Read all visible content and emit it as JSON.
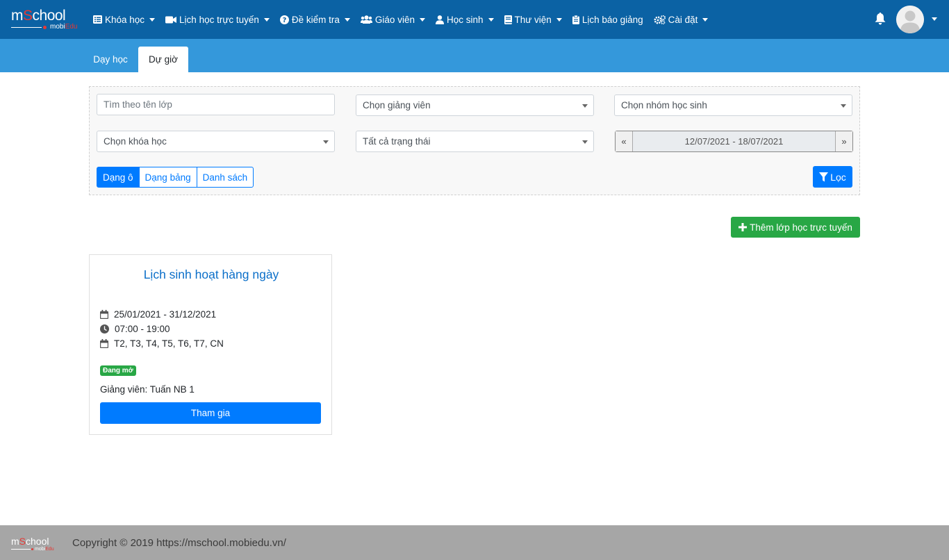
{
  "brand": {
    "logo_main_m": "m",
    "logo_main_s": "S",
    "logo_main_rest": "chool",
    "logo_sub_mobi": "mobi",
    "logo_sub_edu": "Edu"
  },
  "nav": {
    "items": [
      {
        "label": "Khóa học",
        "icon": "list-icon",
        "dropdown": true
      },
      {
        "label": "Lịch học trực tuyến",
        "icon": "video-icon",
        "dropdown": true
      },
      {
        "label": "Đề kiểm tra",
        "icon": "question-circle-icon",
        "dropdown": true
      },
      {
        "label": "Giáo viên",
        "icon": "users-icon",
        "dropdown": true
      },
      {
        "label": "Học sinh",
        "icon": "user-icon",
        "dropdown": true
      },
      {
        "label": "Thư viện",
        "icon": "book-icon",
        "dropdown": true
      },
      {
        "label": "Lịch báo giảng",
        "icon": "clipboard-icon",
        "dropdown": false
      },
      {
        "label": "Cài đặt",
        "icon": "cogs-icon",
        "dropdown": true
      }
    ]
  },
  "tabs": {
    "day_hoc": "Dạy học",
    "du_gio": "Dự giờ",
    "active": "Dự giờ"
  },
  "filters": {
    "class_search_placeholder": "Tìm theo tên lớp",
    "teacher_select": "Chọn giảng viên",
    "student_group_select": "Chọn nhóm học sinh",
    "course_select": "Chọn khóa học",
    "status_select": "Tất cả trạng thái",
    "date_prev": "«",
    "date_range": "12/07/2021 - 18/07/2021",
    "date_next": "»",
    "view_grid": "Dạng ô",
    "view_table": "Dạng bảng",
    "view_list": "Danh sách",
    "active_view": "Dạng ô",
    "filter_button": "Lọc"
  },
  "actions": {
    "add_online_class": "Thêm lớp học trực tuyến"
  },
  "classes": [
    {
      "title": "Lịch sinh hoạt hàng ngày",
      "date_range": "25/01/2021 - 31/12/2021",
      "time": "07:00 - 19:00",
      "days": "T2, T3, T4, T5, T6, T7, CN",
      "status": "Đang mở",
      "teacher": "Giảng viên: Tuấn NB 1",
      "join_label": "Tham gia"
    }
  ],
  "footer": {
    "copyright": "Copyright © 2019 https://mschool.mobiedu.vn/"
  },
  "colors": {
    "navbar": "#0b62a4",
    "tabstrip": "#3498db",
    "primary": "#007bff",
    "success": "#28a745",
    "footer": "#a6a6a6",
    "brand_red": "#e53935"
  }
}
